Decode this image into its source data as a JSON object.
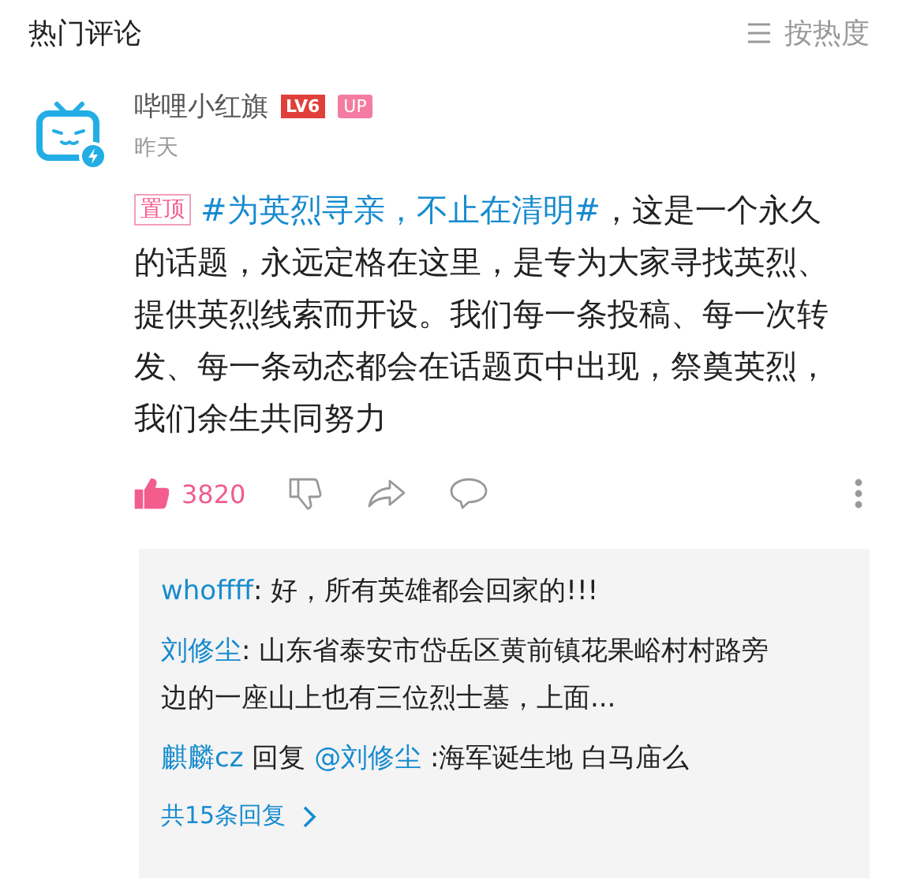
{
  "header": {
    "title": "热门评论",
    "sort_label": "按热度"
  },
  "comment": {
    "user": "哔哩小红旗",
    "level": "LV6",
    "up_badge": "UP",
    "time": "昨天",
    "pinned_label": "置顶",
    "topic": "#为英烈寻亲，不止在清明#",
    "text": "，这是一个永久的话题，永远定格在这里，是专为大家寻找英烈、提供英烈线索而开设。我们每一条投稿、每一次转发、每一条动态都会在话题页中出现，祭奠英烈，我们余生共同努力",
    "likes": "3820",
    "liked": true
  },
  "replies": [
    {
      "kind": "plain",
      "user": "whoffff",
      "text": ": 好，所有英雄都会回家的!!!"
    },
    {
      "kind": "plain",
      "user": "刘修尘",
      "text": ": 山东省泰安市岱岳区黄前镇花果峪村村路旁边的一座山上也有三位烈士墓，上面..."
    },
    {
      "kind": "reply_to",
      "user": "麒麟cz",
      "reply_word": "回复",
      "mention": "@刘修尘",
      "text": ":海军诞生地 白马庙么"
    }
  ],
  "more_replies": "共15条回复"
}
